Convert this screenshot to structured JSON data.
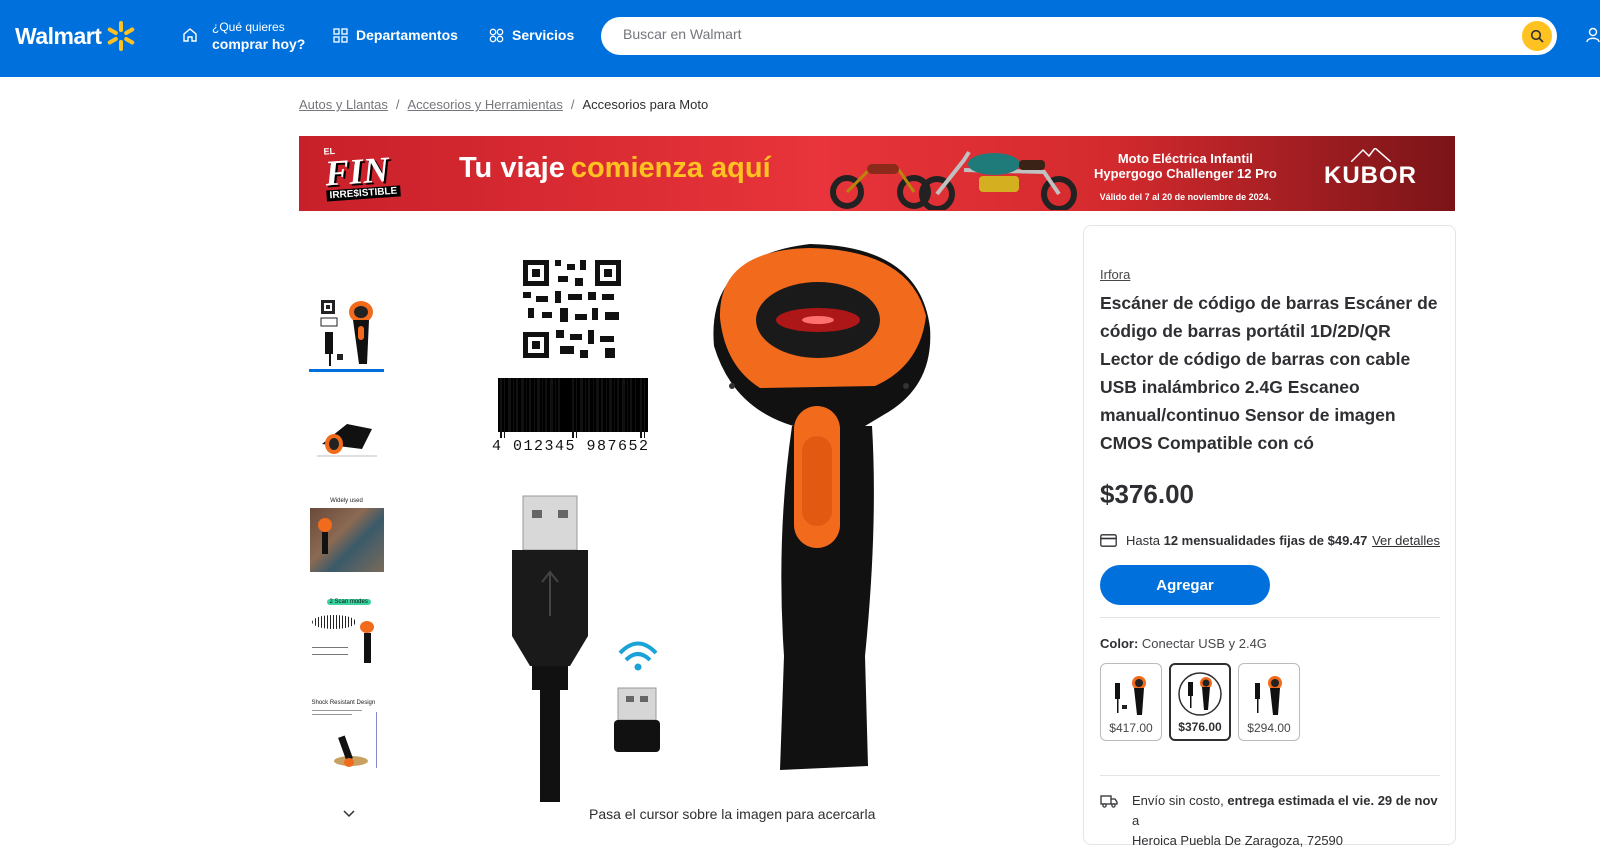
{
  "header": {
    "logo_text": "Walmart",
    "question_small": "¿Qué quieres",
    "question_big": "comprar hoy?",
    "departments_label": "Departamentos",
    "services_label": "Servicios",
    "search_placeholder": "Buscar en Walmart"
  },
  "breadcrumb": {
    "items": [
      "Autos y Llantas",
      "Accesorios y Herramientas",
      "Accesorios para Moto"
    ],
    "separator": "/"
  },
  "banner": {
    "fin_small": "EL",
    "fin_big": "FIN",
    "fin_sub": "IRRE$ISTIBLE",
    "headline_1": "Tu viaje",
    "headline_2": "comienza aquí",
    "product_line_1": "Moto Eléctrica Infantil",
    "product_line_2": "Hypergogo Challenger 12 Pro",
    "valid_text": "Válido del 7 al 20 de noviembre de 2024.",
    "brand": "KUBOR"
  },
  "gallery": {
    "thumb_labels": [
      "",
      "",
      "Widely used",
      "2 Scan modes",
      "Shock Resistant Design"
    ],
    "barcode_digits": "4 012345 987652",
    "hover_hint": "Pasa el cursor sobre la imagen para acercarla"
  },
  "product": {
    "brand": "Irfora",
    "title": "Escáner de código de barras Escáner de código de barras portátil 1D/2D/QR Lector de código de barras con cable USB inalámbrico 2.4G Escaneo manual/continuo Sensor de imagen CMOS Compatible con có",
    "price": "$376.00",
    "installments_prefix": "Hasta",
    "installments_bold": "12 mensualidades fijas de $49.47",
    "installments_link": "Ver detalles",
    "add_button": "Agregar",
    "color_label": "Color:",
    "color_value": "Conectar USB y 2.4G",
    "variants": [
      {
        "price": "$417.00",
        "selected": false
      },
      {
        "price": "$376.00",
        "selected": true
      },
      {
        "price": "$294.00",
        "selected": false
      }
    ],
    "shipping_prefix": "Envío sin costo,",
    "shipping_bold": "entrega estimada el vie. 29 de nov",
    "shipping_suffix": "a",
    "shipping_line2": "Heroica Puebla De Zaragoza, 72590"
  },
  "colors": {
    "header_blue": "#0071dc",
    "spark_yellow": "#ffc220",
    "scanner_orange": "#f26a1b"
  }
}
